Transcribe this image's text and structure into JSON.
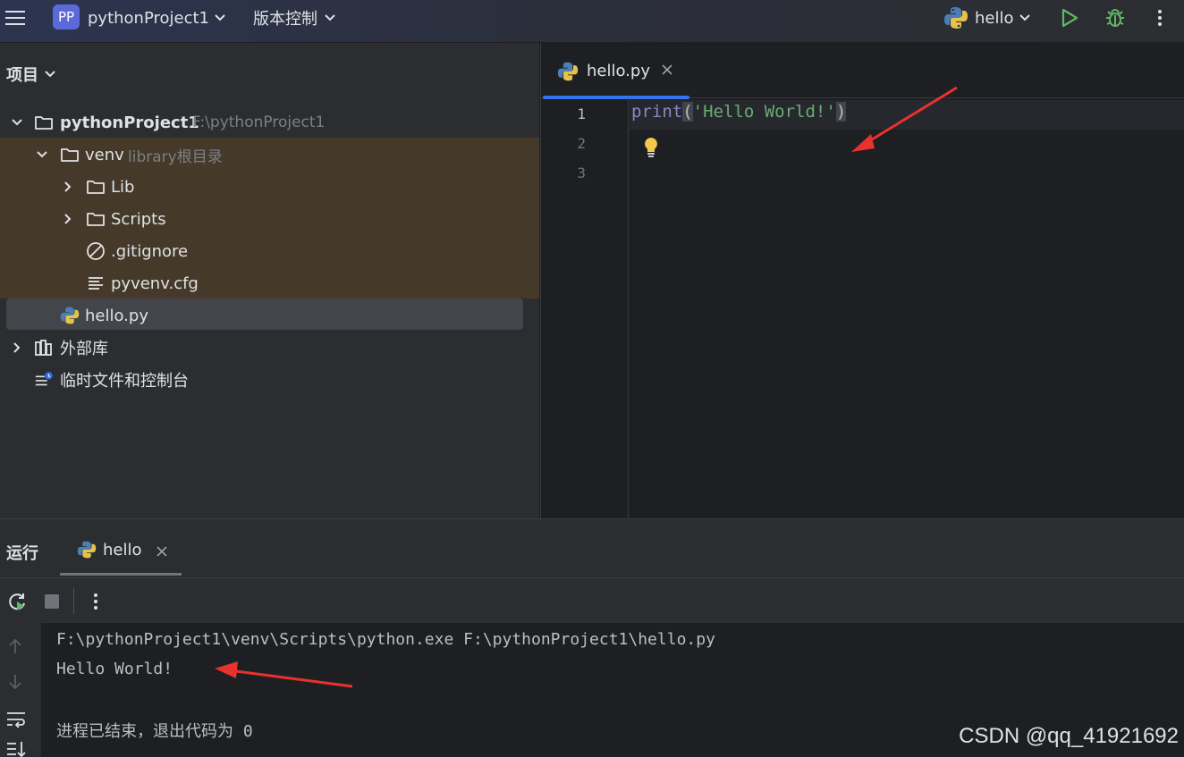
{
  "titlebar": {
    "project_badge": "PP",
    "project_name": "pythonProject1",
    "vcs_label": "版本控制",
    "run_config": "hello"
  },
  "project_panel": {
    "header": "项目",
    "tree": [
      {
        "label": "pythonProject1",
        "hint": "F:\\pythonProject1",
        "kind": "folder",
        "expanded": true
      },
      {
        "label": "venv",
        "hint": "library根目录",
        "kind": "folder",
        "expanded": true
      },
      {
        "label": "Lib",
        "kind": "folder",
        "expanded": false
      },
      {
        "label": "Scripts",
        "kind": "folder",
        "expanded": false
      },
      {
        "label": ".gitignore",
        "kind": "ignore-file"
      },
      {
        "label": "pyvenv.cfg",
        "kind": "text-file"
      },
      {
        "label": "hello.py",
        "kind": "python-file",
        "selected": true
      },
      {
        "label": "外部库",
        "kind": "library",
        "expanded": false
      },
      {
        "label": "临时文件和控制台",
        "kind": "scratch"
      }
    ]
  },
  "editor": {
    "tab_label": "hello.py",
    "line_numbers": [
      "1",
      "2",
      "3"
    ],
    "code": {
      "func": "print",
      "open": "(",
      "string": "'Hello World!'",
      "close": ")"
    }
  },
  "run_panel": {
    "title": "运行",
    "tab_label": "hello",
    "console": [
      "F:\\pythonProject1\\venv\\Scripts\\python.exe F:\\pythonProject1\\hello.py",
      "Hello World!",
      "",
      "进程已结束，退出代码为 0"
    ]
  },
  "watermark": "CSDN @qq_41921692",
  "colors": {
    "accent": "#3574f0",
    "badge": "#5b6ad8",
    "run_green": "#5fb865",
    "venv_highlight": "#45392a",
    "annotation_arrow": "#e8322d"
  }
}
